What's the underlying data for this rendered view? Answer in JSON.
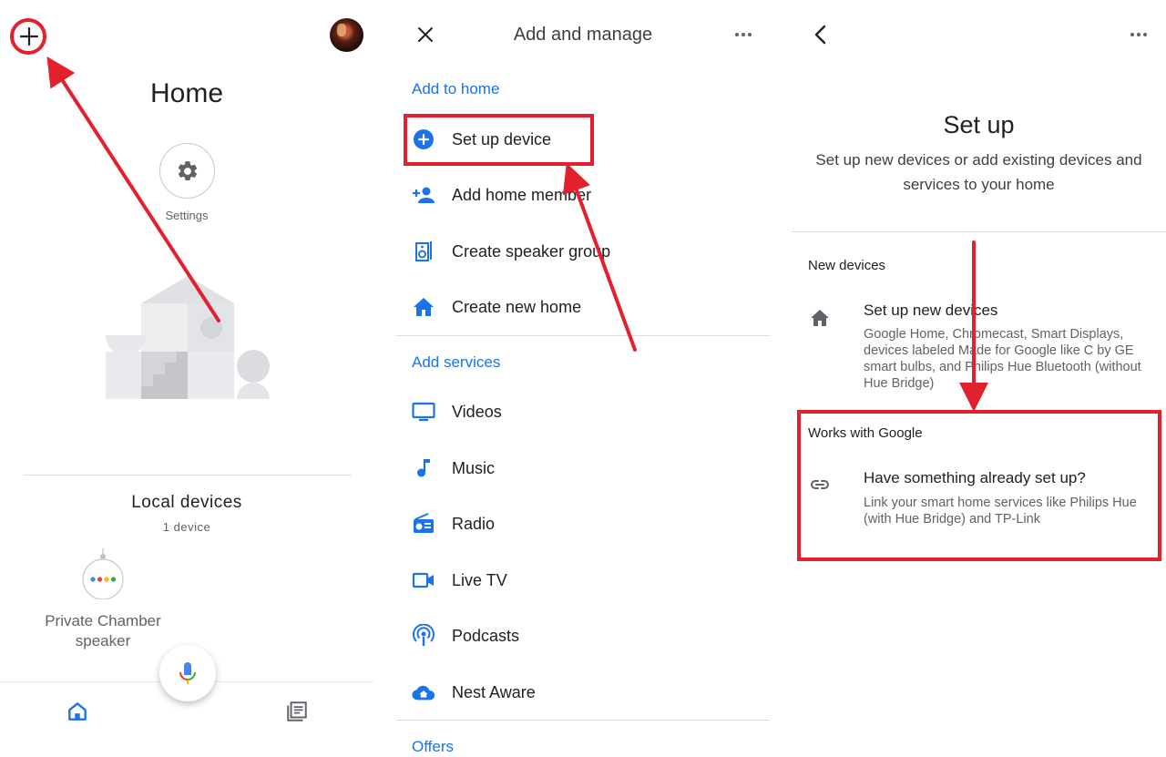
{
  "panel1": {
    "title": "Home",
    "settings_label": "Settings",
    "local_devices_title": "Local devices",
    "local_devices_count": "1 device",
    "device_name": "Private Chamber speaker",
    "icons": [
      "plus-icon",
      "avatar",
      "gear-icon",
      "mic-icon",
      "home-icon",
      "feed-icon"
    ]
  },
  "panel2": {
    "title": "Add and manage",
    "sections": {
      "add_to_home": "Add to home",
      "add_services": "Add services",
      "offers": "Offers"
    },
    "add_to_home_items": [
      {
        "label": "Set up device",
        "icon": "add-circle-icon"
      },
      {
        "label": "Add home member",
        "icon": "person-add-icon"
      },
      {
        "label": "Create speaker group",
        "icon": "speaker-icon"
      },
      {
        "label": "Create new home",
        "icon": "home-icon"
      }
    ],
    "services_items": [
      {
        "label": "Videos",
        "icon": "tv-icon"
      },
      {
        "label": "Music",
        "icon": "music-note-icon"
      },
      {
        "label": "Radio",
        "icon": "radio-icon"
      },
      {
        "label": "Live TV",
        "icon": "video-camera-icon"
      },
      {
        "label": "Podcasts",
        "icon": "podcast-icon"
      },
      {
        "label": "Nest Aware",
        "icon": "cloud-home-icon"
      }
    ]
  },
  "panel3": {
    "title": "Set up",
    "subtitle": "Set up new devices or add existing devices and services to your home",
    "new_devices_section": "New devices",
    "new_devices_title": "Set up new devices",
    "new_devices_desc": "Google Home, Chromecast, Smart Displays, devices labeled Made for Google like C by GE smart bulbs, and Philips Hue Bluetooth (without Hue Bridge)",
    "works_with_section": "Works with Google",
    "works_with_title": "Have something already set up?",
    "works_with_desc": "Link your smart home services like Philips Hue (with Hue Bridge) and TP-Link"
  },
  "colors": {
    "accent": "#1a73e8",
    "annotation": "#e3212e",
    "divider": "#dadce0",
    "secondary_text": "#5f6368"
  }
}
